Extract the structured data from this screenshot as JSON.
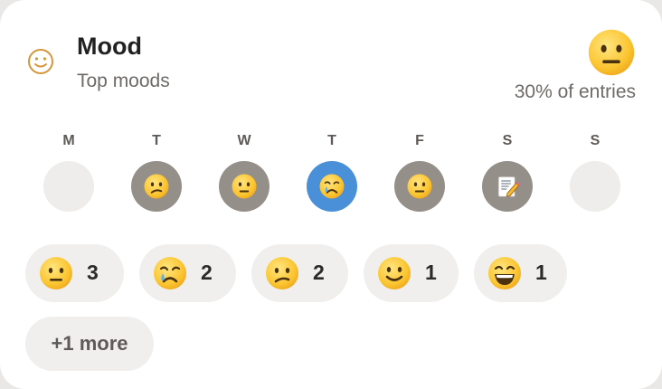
{
  "widget": {
    "header_icon": "smiley-outline-icon",
    "title": "Mood",
    "subtitle": "Top moods",
    "top_mood_icon": "neutral-face-icon",
    "top_mood_percent": "30% of entries"
  },
  "week": [
    {
      "letter": "M",
      "state": "empty"
    },
    {
      "letter": "T",
      "state": "filled",
      "icon": "confused-face-icon"
    },
    {
      "letter": "W",
      "state": "filled",
      "icon": "neutral-face-icon"
    },
    {
      "letter": "T",
      "state": "today",
      "icon": "crying-face-icon"
    },
    {
      "letter": "F",
      "state": "filled",
      "icon": "neutral-face-icon"
    },
    {
      "letter": "S",
      "state": "filled",
      "icon": "memo-icon"
    },
    {
      "letter": "S",
      "state": "empty"
    }
  ],
  "mood_counts": [
    {
      "icon": "neutral-face-icon",
      "count": "3"
    },
    {
      "icon": "crying-face-icon",
      "count": "2"
    },
    {
      "icon": "confused-face-icon",
      "count": "2"
    },
    {
      "icon": "slightly-smiling-face-icon",
      "count": "1"
    },
    {
      "icon": "grinning-face-icon",
      "count": "1"
    }
  ],
  "more_label": "+1 more",
  "colors": {
    "today_circle": "#4a90d9",
    "filled_circle": "#958f8a",
    "empty_circle": "#eeedeb",
    "chip_background": "#f0efed",
    "emoji_yellow": "#fbc531"
  }
}
